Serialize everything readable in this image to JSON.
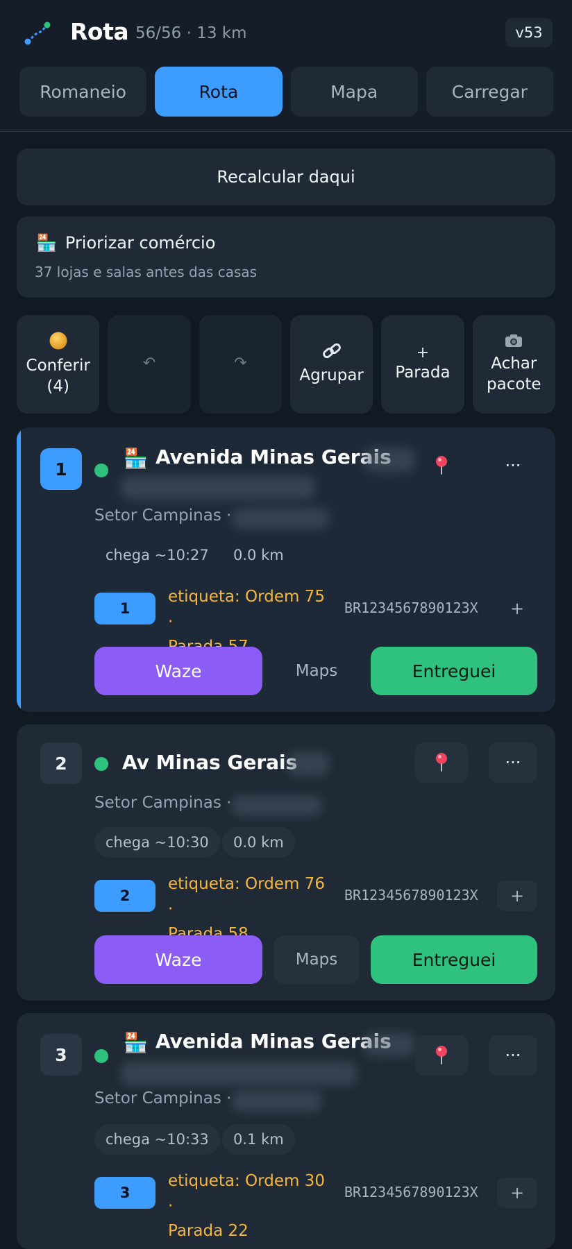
{
  "header": {
    "title": "Rota",
    "subtitle": "56/56 · 13 km",
    "version": "v53"
  },
  "tabs": [
    {
      "label": "Romaneio",
      "active": false
    },
    {
      "label": "Rota",
      "active": true
    },
    {
      "label": "Mapa",
      "active": false
    },
    {
      "label": "Carregar",
      "active": false
    }
  ],
  "recalc_label": "Recalcular daqui",
  "prioritize": {
    "icon": "shop-24h-icon",
    "title": "Priorizar comércio",
    "subtitle": "37 lojas e salas antes das casas"
  },
  "tools": {
    "check": {
      "icon": "orange-circle-icon",
      "label_line1": "Conferir",
      "label_line2": "(4)"
    },
    "undo": {
      "icon": "undo-icon",
      "glyph": "↶"
    },
    "redo": {
      "icon": "redo-icon",
      "glyph": "↷"
    },
    "group": {
      "icon": "link-icon",
      "label": "Agrupar"
    },
    "add_stop": {
      "glyph": "+",
      "label": "Parada"
    },
    "find": {
      "icon": "camera-icon",
      "label_line1": "Achar",
      "label_line2": "pacote"
    }
  },
  "stops": [
    {
      "number": "1",
      "address": "Avenida Minas Gerais",
      "sector": "Setor Campinas ·",
      "eta": "chega ~10:27",
      "distance": "0.0 km",
      "badge": "1",
      "label_line1": "etiqueta: Ordem 75 ·",
      "label_line2": "Parada 57",
      "code": "BR1234567890123X",
      "plus": "+",
      "more": "···",
      "waze": "Waze",
      "maps": "Maps",
      "delivered": "Entreguei"
    },
    {
      "number": "2",
      "address": "Av Minas Gerais",
      "sector": "Setor Campinas ·",
      "eta": "chega ~10:30",
      "distance": "0.0 km",
      "badge": "2",
      "label_line1": "etiqueta: Ordem 76 ·",
      "label_line2": "Parada 58",
      "code": "BR1234567890123X",
      "plus": "+",
      "more": "···",
      "waze": "Waze",
      "maps": "Maps",
      "delivered": "Entreguei"
    },
    {
      "number": "3",
      "address": "Avenida Minas Gerais",
      "sector": "Setor Campinas ·",
      "eta": "chega ~10:33",
      "distance": "0.1 km",
      "badge": "3",
      "label_line1": "etiqueta: Ordem 30 ·",
      "label_line2": "Parada 22",
      "code": "BR1234567890123X",
      "plus": "+",
      "more": "···"
    }
  ],
  "colors": {
    "accent": "#3d9cff",
    "waze": "#8b5cf6",
    "delivered": "#2ec27e",
    "label": "#f5b63b",
    "status_dot": "#2ec27e"
  }
}
